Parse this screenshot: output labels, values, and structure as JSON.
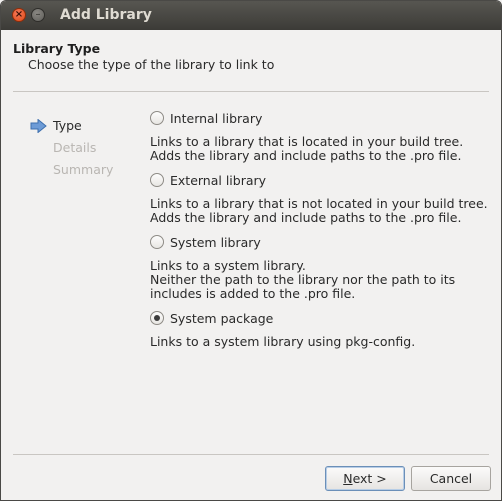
{
  "window": {
    "title": "Add Library",
    "close_glyph": "×",
    "minimize_glyph": "–"
  },
  "header": {
    "title": "Library Type",
    "subtitle": "Choose the type of the library to link to"
  },
  "steps": [
    {
      "label": "Type",
      "state": "current"
    },
    {
      "label": "Details",
      "state": "pending"
    },
    {
      "label": "Summary",
      "state": "pending"
    }
  ],
  "options": [
    {
      "label": "Internal library",
      "checked": false,
      "desc": [
        "Links to a library that is located in your build tree.",
        "Adds the library and include paths to the .pro file."
      ]
    },
    {
      "label": "External library",
      "checked": false,
      "desc": [
        "Links to a library that is not located in your build tree.",
        "Adds the library and include paths to the .pro file."
      ]
    },
    {
      "label": "System library",
      "checked": false,
      "desc": [
        "Links to a system library.",
        "Neither the path to the library nor the path to its",
        "includes is added to the .pro file."
      ]
    },
    {
      "label": "System package",
      "checked": true,
      "desc": [
        "Links to a system library using pkg-config."
      ]
    }
  ],
  "buttons": {
    "next_mnemonic": "N",
    "next_rest": "ext >",
    "cancel": "Cancel"
  },
  "colors": {
    "arrow": "#6d9bd6",
    "titlebar": "#3c3b37"
  }
}
